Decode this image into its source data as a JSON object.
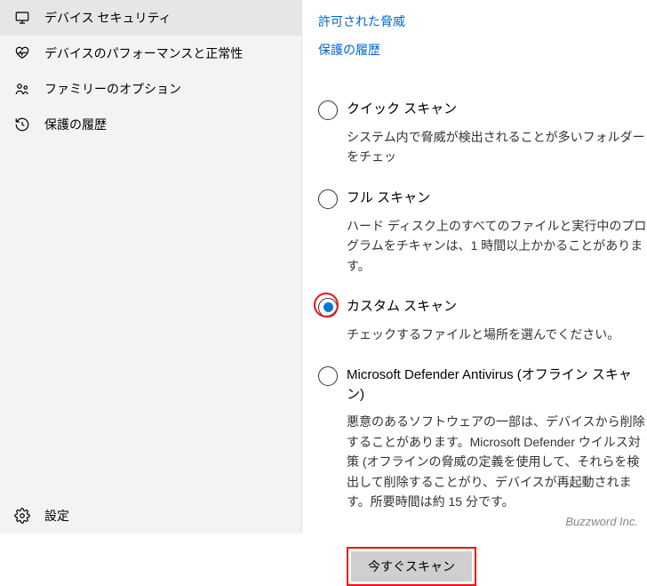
{
  "sidebar": {
    "items": [
      {
        "icon": "monitor-icon",
        "label": "デバイス セキュリティ"
      },
      {
        "icon": "heartbeat-icon",
        "label": "デバイスのパフォーマンスと正常性"
      },
      {
        "icon": "family-icon",
        "label": "ファミリーのオプション"
      },
      {
        "icon": "history-icon",
        "label": "保護の履歴"
      }
    ],
    "settings_label": "設定"
  },
  "main": {
    "link_allowed": "許可された脅威",
    "link_history": "保護の履歴",
    "options": {
      "quick": {
        "label": "クイック スキャン",
        "desc": "システム内で脅威が検出されることが多いフォルダーをチェッ"
      },
      "full": {
        "label": "フル スキャン",
        "desc": "ハード ディスク上のすべてのファイルと実行中のプログラムをチキャンは、1 時間以上かかることがあります。"
      },
      "custom": {
        "label": "カスタム スキャン",
        "desc": "チェックするファイルと場所を選んでください。"
      },
      "offline": {
        "label": "Microsoft Defender Antivirus (オフライン スキャン)",
        "desc": "悪意のあるソフトウェアの一部は、デバイスから削除することがあります。Microsoft Defender ウイルス対策 (オフラインの脅威の定義を使用して、それらを検出して削除することがり、デバイスが再起動されます。所要時間は約 15 分です。"
      }
    },
    "scan_button": "今すぐスキャン"
  },
  "footer": "Buzzword Inc."
}
